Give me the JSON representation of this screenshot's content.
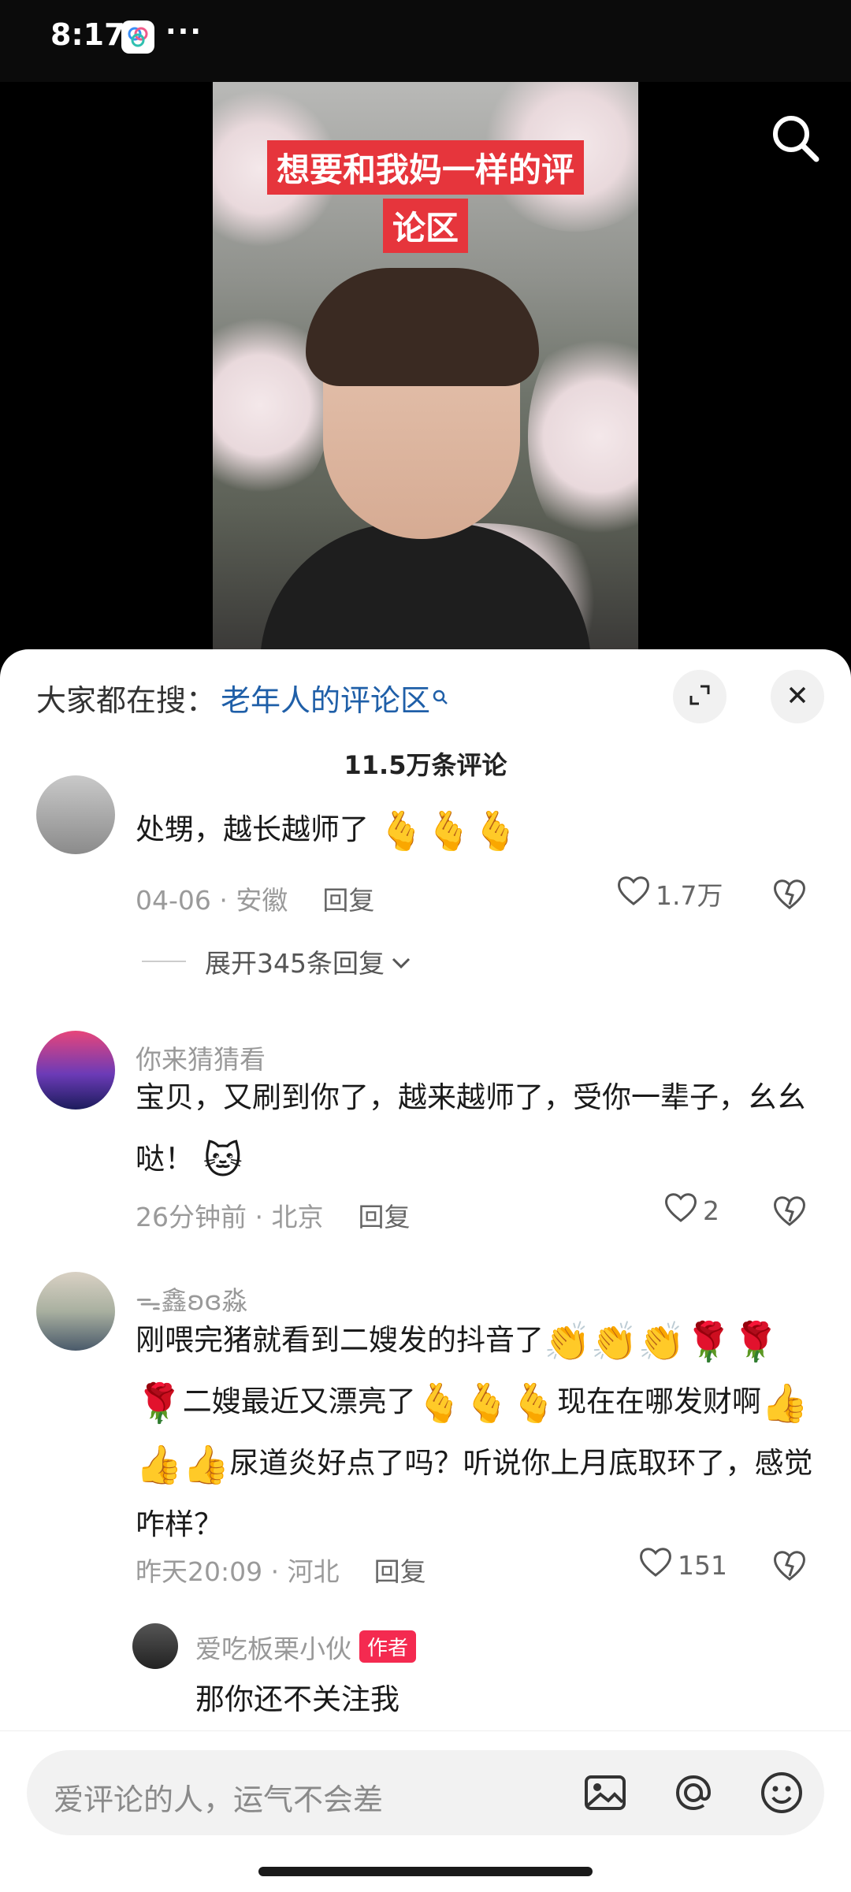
{
  "status_bar": {
    "time": "8:17",
    "overflow": "···"
  },
  "video": {
    "caption_line1": "想要和我妈一样的评",
    "caption_line2": "论区"
  },
  "sheet": {
    "hot_search_label": "大家都在搜：",
    "hot_search_keyword": "老年人的评论区",
    "comment_count": "11.5万条评论"
  },
  "comments": [
    {
      "text": "处甥，越长越师了",
      "emojis": [
        "🫰",
        "🫰",
        "🫰"
      ],
      "date": "04-06 · 安徽",
      "reply": "回复",
      "likes": "1.7万",
      "expand": "展开345条回复"
    },
    {
      "username": "你来猜猜看",
      "text": "宝贝，又刷到你了，越来越师了，受你一辈子，幺幺哒！",
      "emoji": "🐱",
      "date": "26分钟前 · 北京",
      "reply": "回复",
      "likes": "2"
    },
    {
      "username": "ᯓ鑫ʚɞ淼",
      "text_parts": [
        "刚喂完猪就看到二嫂发的抖音了",
        "二嫂最近又漂亮了",
        "现在在哪发财啊",
        "尿道炎好点了吗？听说你上月底取环了，感觉咋样？"
      ],
      "emojis_a": [
        "👏",
        "👏",
        "👏",
        "🌹",
        "🌹",
        "🌹"
      ],
      "emojis_b": [
        "🫰",
        "🫰",
        "🫰"
      ],
      "emojis_c": [
        "👍",
        "👍",
        "👍"
      ],
      "date": "昨天20:09 · 河北",
      "reply": "回复",
      "likes": "151",
      "sub_reply": {
        "username": "爱吃板栗小伙",
        "tag": "作者",
        "text": "那你还不关注我"
      }
    }
  ],
  "input": {
    "placeholder": "爱评论的人，运气不会差"
  },
  "icons": [
    "search-icon",
    "expand-icon",
    "close-icon",
    "heart-icon",
    "dislike-icon",
    "chevron-down-icon",
    "image-icon",
    "at-icon",
    "emoji-icon"
  ],
  "colors": {
    "accent_red": "#e6353c",
    "link_blue": "#1f5fa8",
    "author_tag": "#f42a50"
  }
}
